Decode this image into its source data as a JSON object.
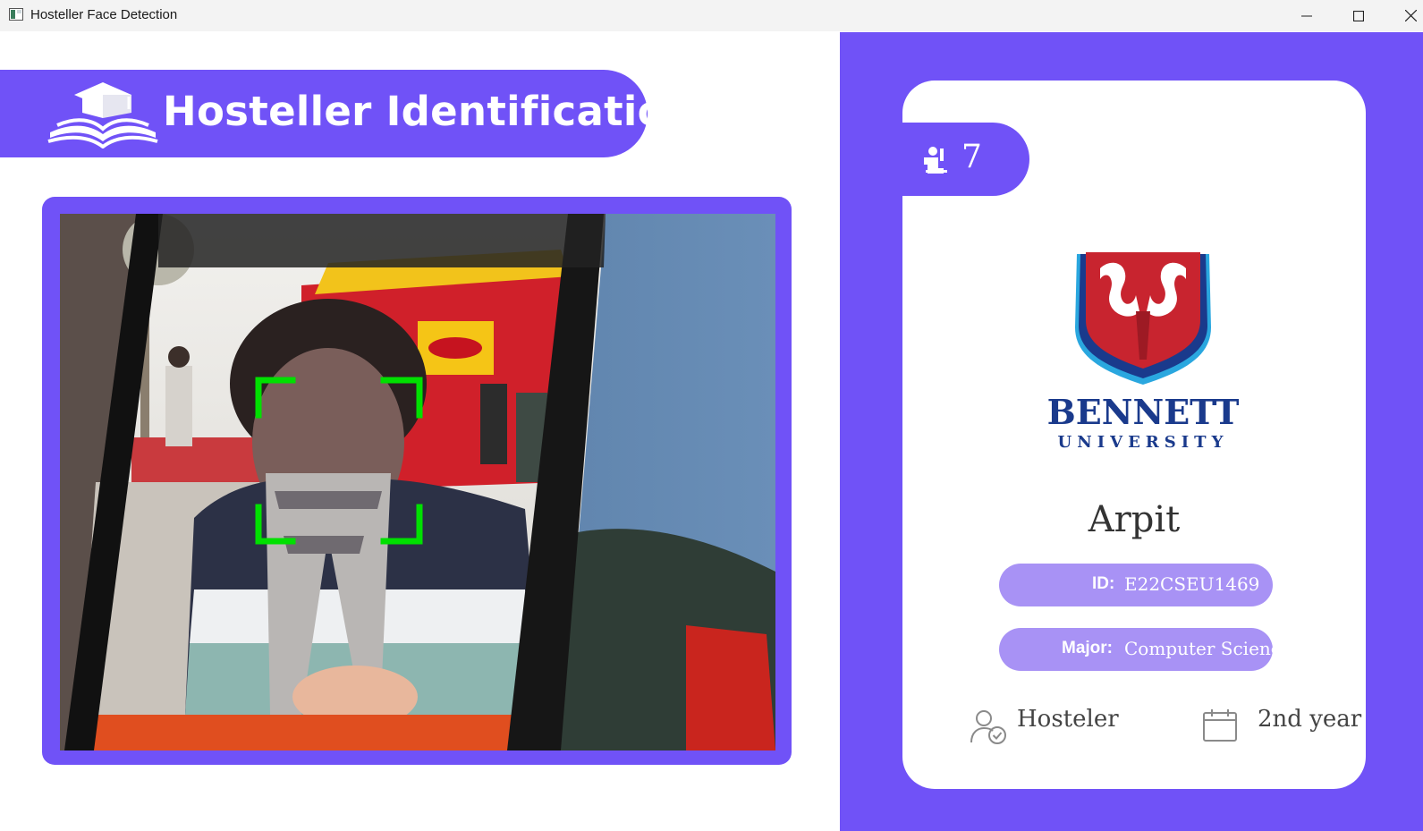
{
  "window": {
    "title": "Hosteller Face Detection",
    "controls": {
      "minimize": "minimize-icon",
      "maximize": "maximize-icon",
      "close": "close-icon"
    }
  },
  "header": {
    "title": "Hosteller Identification",
    "icon": "graduation-cap-book-icon"
  },
  "camera": {
    "face_box_color": "#00e000"
  },
  "profile": {
    "count": "7",
    "count_icon": "person-raise-hand-icon",
    "logo_wordmark": "BENNETT",
    "logo_subtext": "UNIVERSITY",
    "name": "Arpit",
    "id_label": "ID:",
    "id_value": "E22CSEU1469",
    "major_label": "Major:",
    "major_value": "Computer Science",
    "status_icon": "user-check-icon",
    "status": "Hosteler",
    "year_icon": "calendar-icon",
    "year": "2nd year"
  },
  "colors": {
    "accent": "#7052f7",
    "pill_light": "#a892f5",
    "logo_red": "#c8242f",
    "logo_blue": "#1a3a8c",
    "logo_cyan": "#2aa7df"
  }
}
